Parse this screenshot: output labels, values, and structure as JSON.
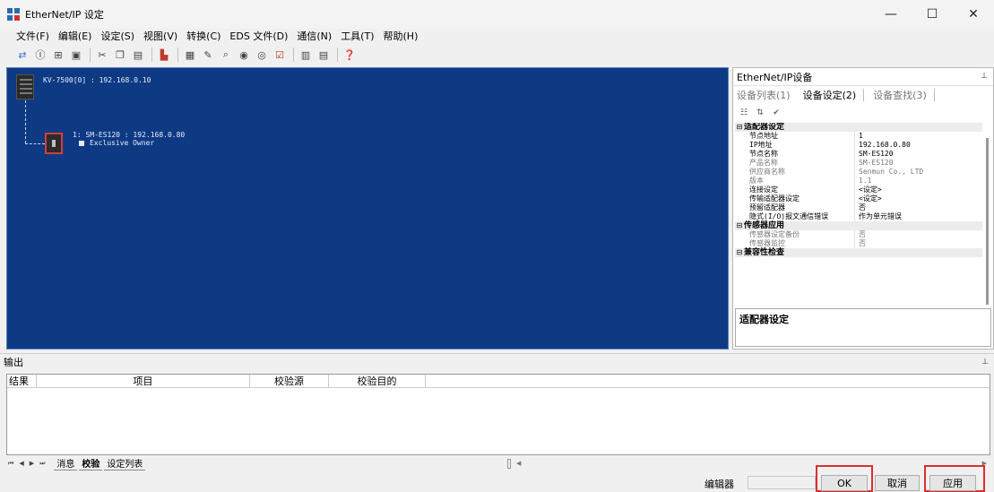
{
  "window": {
    "title": "EtherNet/IP 设定",
    "controls": [
      "—",
      "☐",
      "✕"
    ]
  },
  "menubar": [
    "文件(F)",
    "编辑(E)",
    "设定(S)",
    "视图(V)",
    "转换(C)",
    "EDS 文件(D)",
    "通信(N)",
    "工具(T)",
    "帮助(H)"
  ],
  "toolbar": {
    "group1": [
      "connect-icon",
      "info-icon",
      "network-icon",
      "module-icon"
    ],
    "group2": [
      "cut-icon",
      "copy-icon",
      "paste-icon"
    ],
    "group3": [
      "device-icon"
    ],
    "group4": [
      "edit-icon",
      "pen-icon",
      "search-icon",
      "online-icon",
      "monitor-icon",
      "check-icon"
    ],
    "group5": [
      "grid-icon",
      "table-icon"
    ],
    "group6": [
      "help-icon"
    ]
  },
  "canvas": {
    "plc_label": "KV-7500[0] : 192.168.0.10",
    "device_label": "1: SM-ES120 : 192.168.0.80",
    "device_sub": "Exclusive Owner"
  },
  "right_panel": {
    "title": "EtherNet/IP设备",
    "tabs": [
      "设备列表(1)",
      "设备设定(2)",
      "设备查找(3)"
    ],
    "categories": [
      {
        "name": "适配器设定",
        "rows": [
          {
            "name": "节点地址",
            "value": "1",
            "dim": false
          },
          {
            "name": "IP地址",
            "value": "192.168.0.80",
            "dim": false
          },
          {
            "name": "节点名称",
            "value": "SM-ES120",
            "dim": false
          },
          {
            "name": "产品名称",
            "value": "SM-ES120",
            "dim": true
          },
          {
            "name": "供应商名称",
            "value": "Senmun Co., LTD",
            "dim": true
          },
          {
            "name": "版本",
            "value": "1.1",
            "dim": true
          },
          {
            "name": "连接设定",
            "value": "<设定>",
            "dim": false
          },
          {
            "name": "传输适配器设定",
            "value": "<设定>",
            "dim": false
          },
          {
            "name": "预留适配器",
            "value": "否",
            "dim": false
          },
          {
            "name": "隐式(I/O)报文通信错误",
            "value": "作为单元错误",
            "dim": false
          }
        ]
      },
      {
        "name": "传感器应用",
        "rows": [
          {
            "name": "传感器设定备份",
            "value": "否",
            "dim": true
          },
          {
            "name": "传感器监控",
            "value": "否",
            "dim": true
          }
        ]
      },
      {
        "name": "兼容性检查",
        "rows": []
      }
    ],
    "description": "适配器设定"
  },
  "output": {
    "title": "输出",
    "columns": [
      "结果",
      "项目",
      "校验源",
      "校验目的"
    ],
    "tabs": [
      "消息",
      "校验",
      "设定列表"
    ],
    "active_tab": "校验"
  },
  "statusbar": {
    "mode": "编辑器",
    "ok_label": "OK",
    "cancel_label": "取消",
    "apply_label": "应用"
  },
  "colors": {
    "canvas_bg": "#0e3a84",
    "highlight": "#d9302c"
  }
}
